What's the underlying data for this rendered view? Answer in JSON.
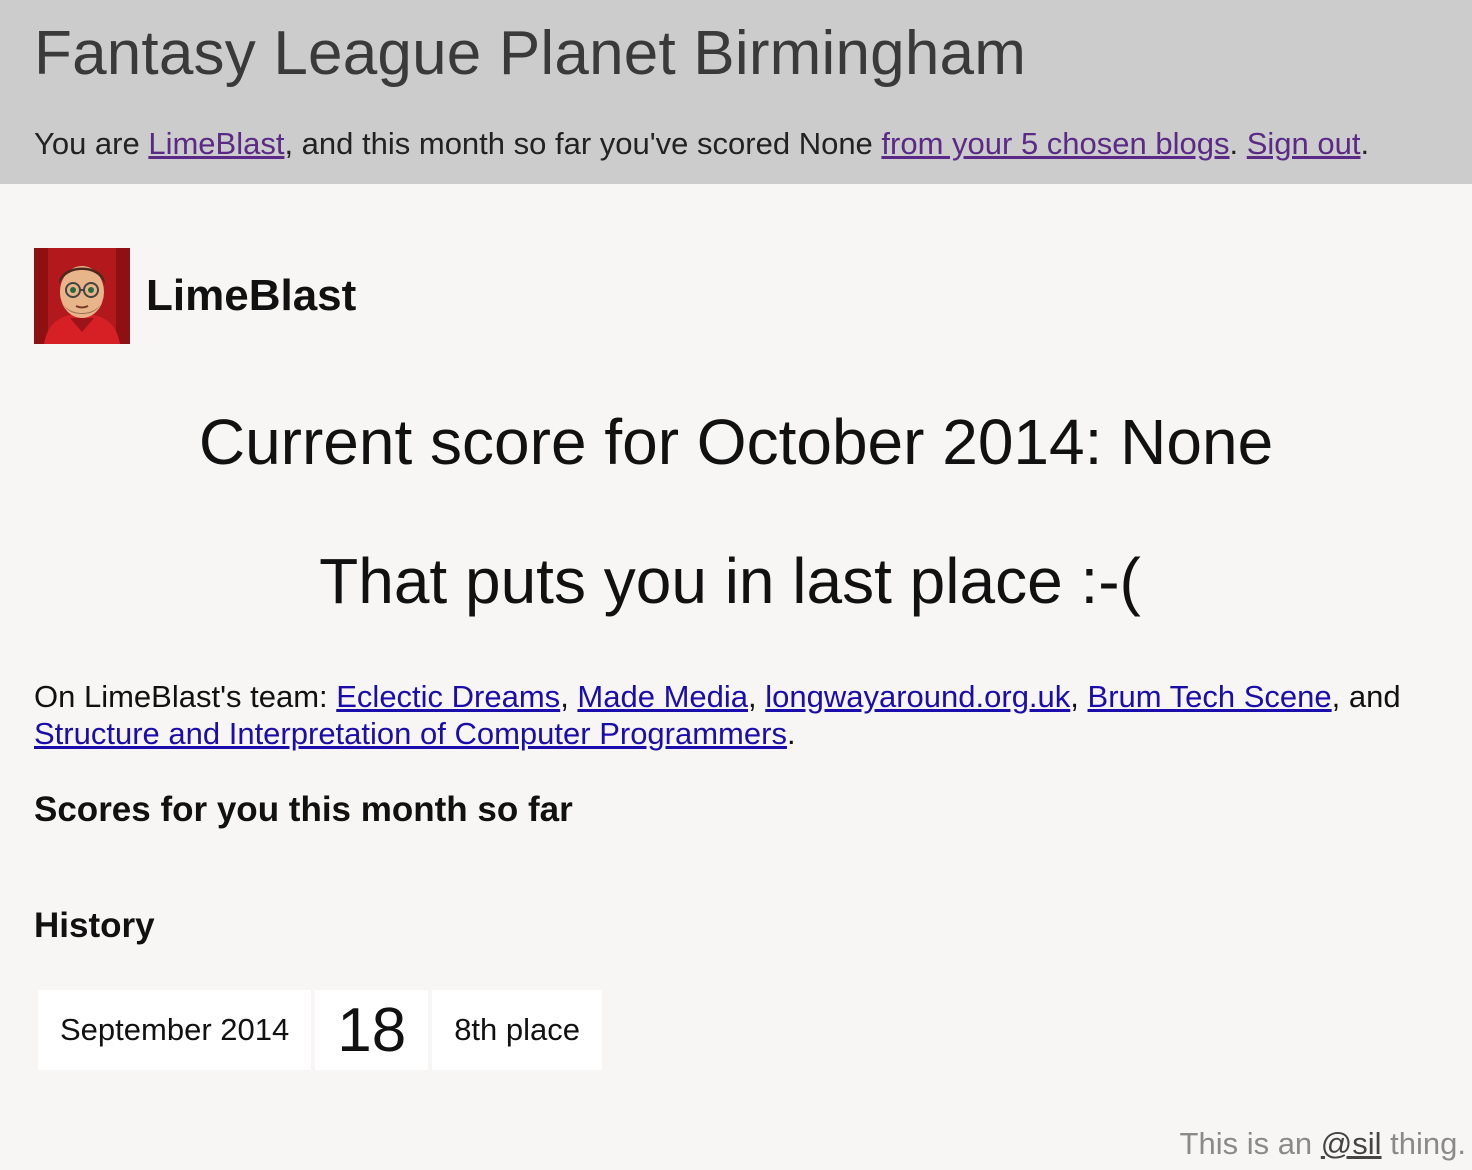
{
  "header": {
    "title": "Fantasy League Planet Birmingham",
    "status": {
      "prefix": "You are ",
      "user_link": "LimeBlast",
      "middle": ", and this month so far you've scored None ",
      "blogs_link": "from your 5 chosen blogs",
      "sep": ". ",
      "signout_link": "Sign out",
      "suffix": "."
    }
  },
  "profile": {
    "name": "LimeBlast",
    "avatar_icon": "avatar-cartoon-icon"
  },
  "score": {
    "current": "Current score for October 2014: None",
    "place": "That puts you in last place :-("
  },
  "team": {
    "prefix": "On LimeBlast's team: ",
    "blogs": [
      "Eclectic Dreams",
      "Made Media",
      "longwayaround.org.uk",
      "Brum Tech Scene",
      "Structure and Interpretation of Computer Programmers"
    ],
    "sep": ", ",
    "and": ", and ",
    "suffix": "."
  },
  "sections": {
    "scores_heading": "Scores for you this month so far",
    "history_heading": "History"
  },
  "history": [
    {
      "month": "September 2014",
      "score": "18",
      "place": "8th place"
    }
  ],
  "footer": {
    "prefix": "This is an ",
    "link": "@sil",
    "suffix": " thing."
  },
  "colors": {
    "header_bg": "#cccccc",
    "page_bg": "#f7f6f5",
    "link": "#1a0dab",
    "visited_link": "#5b2a86"
  }
}
